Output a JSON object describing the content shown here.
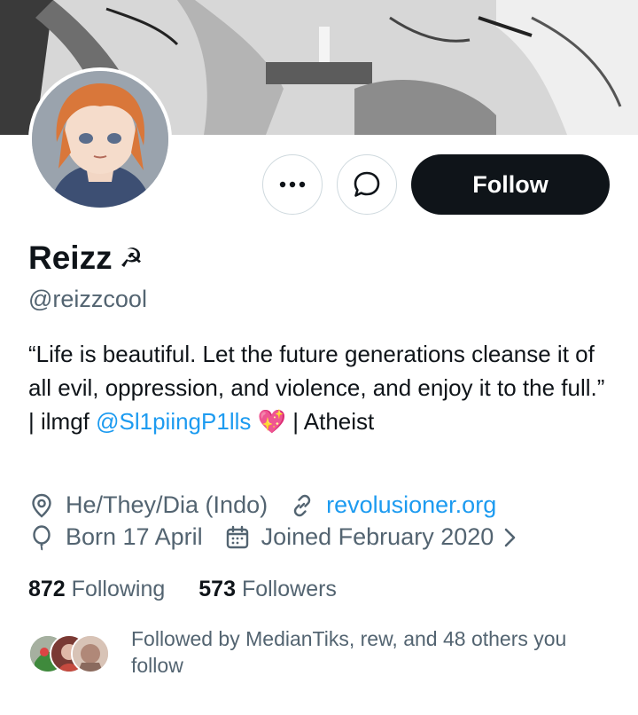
{
  "profile": {
    "name": "Reizz",
    "name_emoji": "☭",
    "handle": "@reizzcool"
  },
  "actions": {
    "more_icon": "more-horizontal-icon",
    "message_icon": "message-bubble-icon",
    "follow_label": "Follow"
  },
  "bio": {
    "part1": "“Life is beautiful. Let the future generations cleanse it of all evil, oppression, and violence, and enjoy it to the full.” | ilmgf ",
    "mention": "@Sl1piingP1lls",
    "emoji": "💖",
    "part2": " | Atheist"
  },
  "meta": {
    "pronouns": "He/They/Dia (Indo)",
    "website": "revolusioner.org",
    "birthday": "Born 17 April",
    "joined": "Joined February 2020"
  },
  "stats": {
    "following_count": "872",
    "following_label": "Following",
    "followers_count": "573",
    "followers_label": "Followers"
  },
  "followed_by": {
    "text": "Followed by MedianTiks, rew, and 48 others you follow"
  },
  "colors": {
    "accent": "#1d9bf0",
    "text_primary": "#0f1419",
    "text_secondary": "#536471",
    "follow_bg": "#0f1419",
    "border": "#cfd9de"
  }
}
